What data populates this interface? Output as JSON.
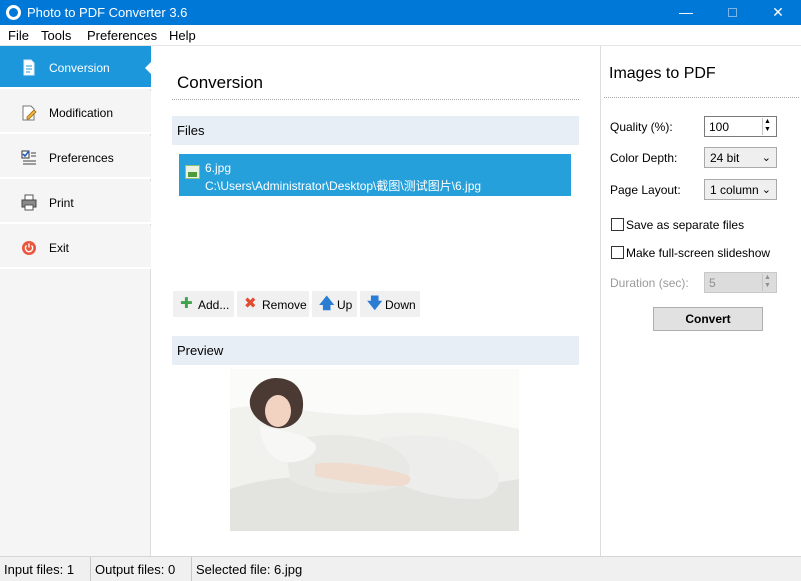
{
  "window": {
    "title": "Photo to PDF Converter 3.6",
    "controls": {
      "minimize": "—",
      "close": "✕"
    }
  },
  "menu": [
    "File",
    "Tools",
    "Preferences",
    "Help"
  ],
  "sidebar": {
    "items": [
      {
        "label": "Conversion",
        "icon": "document-convert-icon",
        "active": true
      },
      {
        "label": "Modification",
        "icon": "edit-pencil-icon",
        "active": false
      },
      {
        "label": "Preferences",
        "icon": "checklist-icon",
        "active": false
      },
      {
        "label": "Print",
        "icon": "printer-icon",
        "active": false
      },
      {
        "label": "Exit",
        "icon": "power-icon",
        "active": false
      }
    ]
  },
  "main": {
    "heading": "Conversion",
    "files_section": "Files",
    "files": [
      {
        "name": "6.jpg",
        "path": "C:\\Users\\Administrator\\Desktop\\截图\\测试图片\\6.jpg",
        "selected": true
      }
    ],
    "toolbar": {
      "add": "Add...",
      "remove": "Remove",
      "up": "Up",
      "down": "Down"
    },
    "preview_section": "Preview"
  },
  "right": {
    "heading": "Images to PDF",
    "quality": {
      "label": "Quality (%):",
      "value": "100"
    },
    "color_depth": {
      "label": "Color Depth:",
      "value": "24 bit"
    },
    "page_layout": {
      "label": "Page Layout:",
      "value": "1 column"
    },
    "save_separate": {
      "label": "Save as separate files",
      "checked": false
    },
    "slideshow": {
      "label": "Make full-screen slideshow",
      "checked": false
    },
    "duration": {
      "label": "Duration (sec):",
      "value": "5",
      "enabled": false
    },
    "convert": "Convert"
  },
  "status": {
    "input": "Input files: 1",
    "output": "Output files: 0",
    "selected": "Selected file: 6.jpg"
  },
  "colors": {
    "titlebar": "#0078d7",
    "active_nav": "#1c97dc",
    "selection": "#26a0da",
    "section_bar": "#e7eef6"
  }
}
